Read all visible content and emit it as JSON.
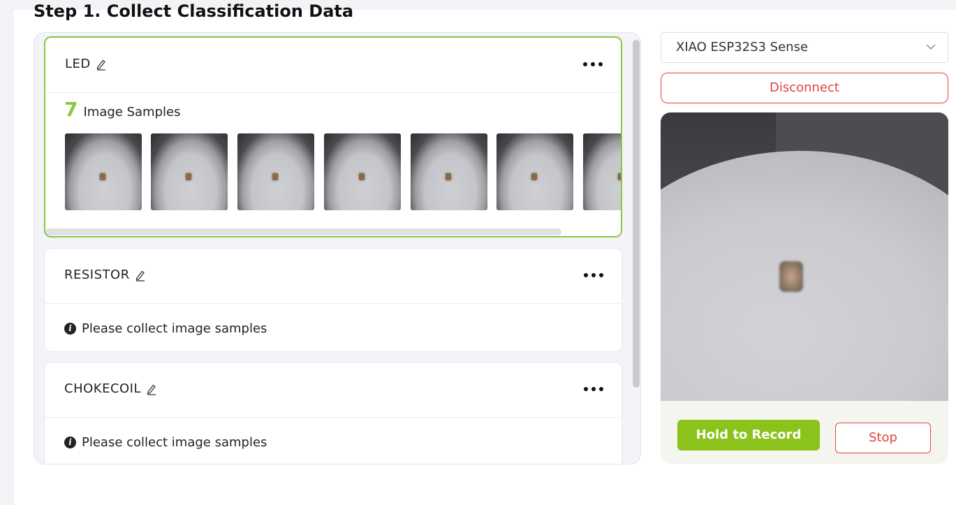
{
  "step": {
    "title": "Step 1. Collect Classification Data"
  },
  "classes": [
    {
      "name": "LED",
      "sample_count": "7",
      "sample_label": "Image Samples",
      "thumbnail_count": 7
    },
    {
      "name": "RESISTOR",
      "empty_message": "Please collect image samples"
    },
    {
      "name": "CHOKECOIL",
      "empty_message": "Please collect image samples"
    }
  ],
  "device": {
    "selected": "XIAO ESP32S3 Sense"
  },
  "buttons": {
    "disconnect": "Disconnect",
    "hold_to_record": "Hold to Record",
    "stop": "Stop"
  },
  "colors": {
    "accent_green": "#8cc63f",
    "danger_red": "#e0453c"
  },
  "icons": {
    "edit": "pencil-icon",
    "more": "more-dots-icon",
    "info": "info-icon",
    "dropdown": "chevron-down-icon"
  }
}
